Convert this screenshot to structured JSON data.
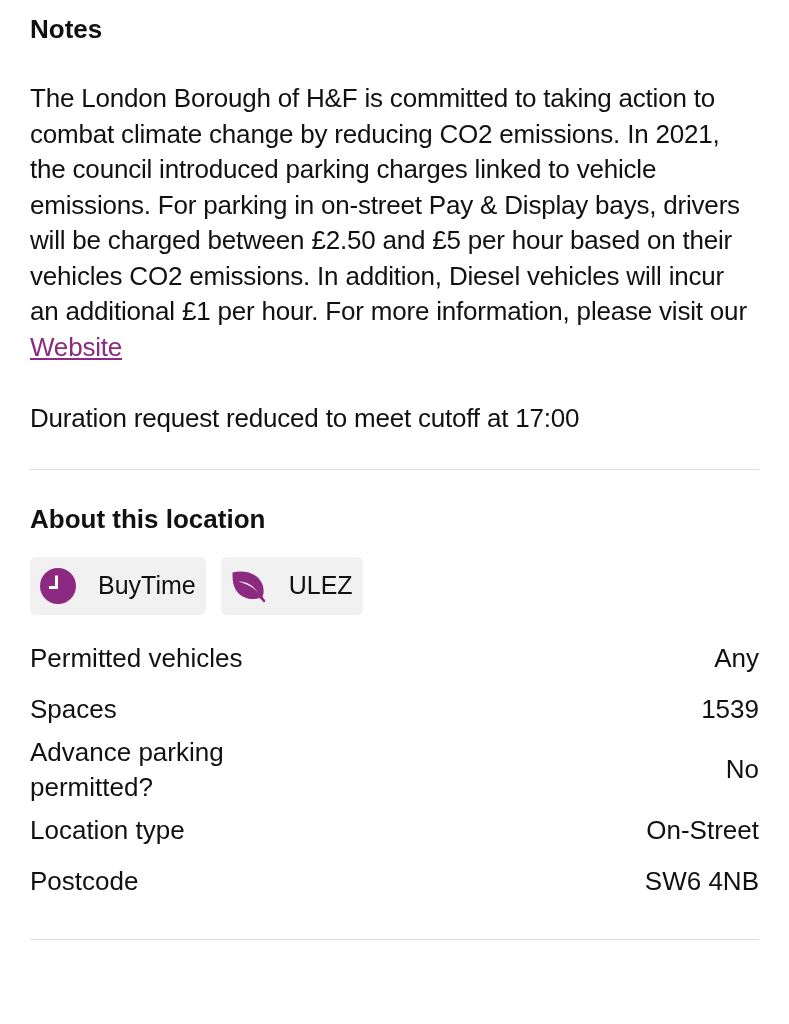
{
  "notes": {
    "title": "Notes",
    "paragraph": "The London Borough of H&F is committed to taking action to combat climate change by reducing CO2 emissions. In 2021, the council introduced parking charges linked to vehicle emissions. For parking in on-street Pay & Display bays, drivers will be charged between £2.50 and £5 per hour based on their vehicles CO2 emissions. In addition, Diesel vehicles will incur an additional £1 per hour. For more information, please visit our",
    "link": "Website",
    "duration_note": "Duration request reduced to meet cutoff at 17:00"
  },
  "about": {
    "title": "About this location",
    "chips": [
      {
        "kind": "clock",
        "label": "BuyTime"
      },
      {
        "kind": "leaf",
        "label": "ULEZ"
      }
    ],
    "rows": [
      {
        "label": "Permitted vehicles",
        "value": "Any"
      },
      {
        "label": "Spaces",
        "value": "1539"
      },
      {
        "label": "Advance parking permitted?",
        "value": "No"
      },
      {
        "label": "Location type",
        "value": "On-Street"
      },
      {
        "label": "Postcode",
        "value": "SW6 4NB"
      }
    ]
  }
}
